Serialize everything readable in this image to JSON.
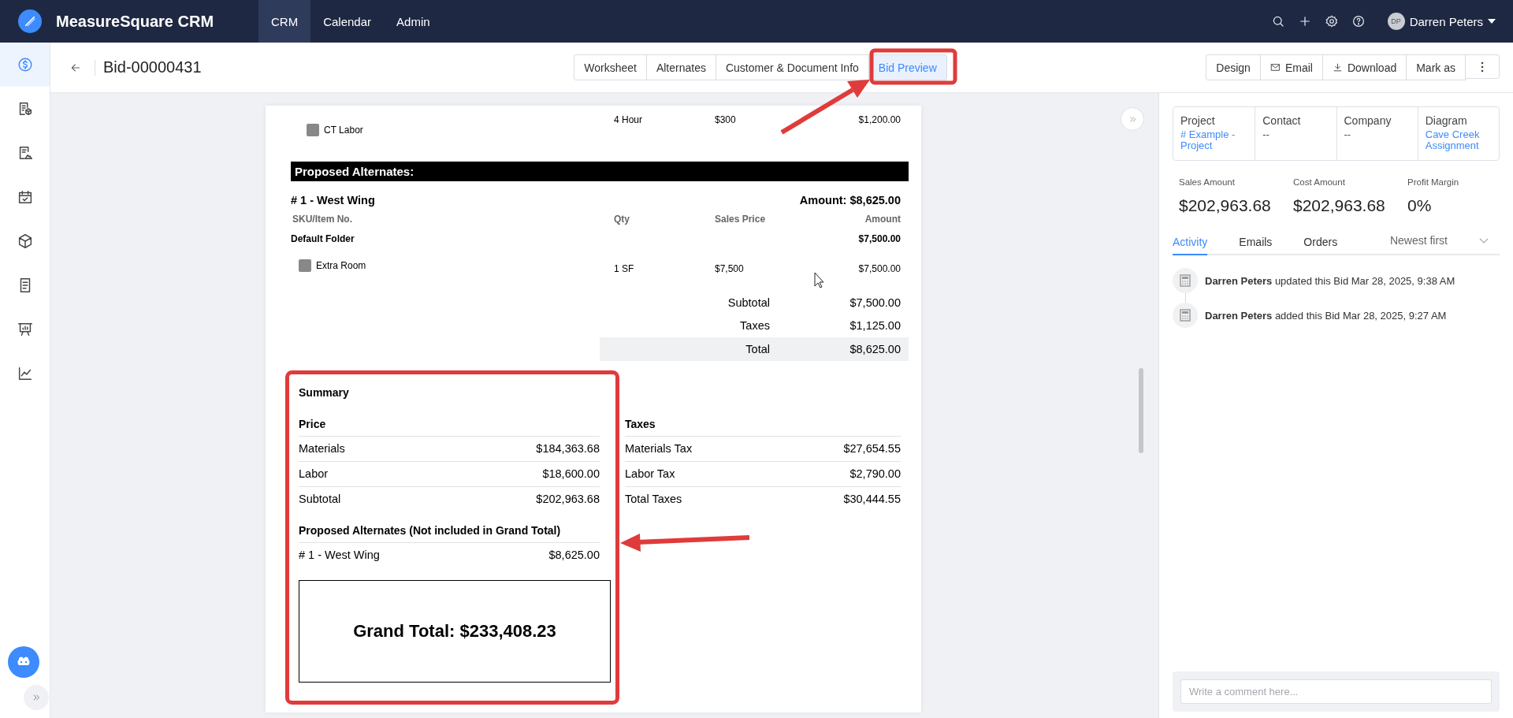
{
  "app": {
    "title": "MeasureSquare CRM",
    "nav": [
      {
        "label": "CRM",
        "selected": true
      },
      {
        "label": "Calendar",
        "selected": false
      },
      {
        "label": "Admin",
        "selected": false
      }
    ],
    "user": {
      "initials": "DP",
      "name": "Darren Peters"
    }
  },
  "sidebar": {
    "items": [
      {
        "selected": true
      },
      {
        "selected": false
      },
      {
        "selected": false
      },
      {
        "selected": false
      },
      {
        "selected": false
      },
      {
        "selected": false
      },
      {
        "selected": false
      },
      {
        "selected": false
      }
    ]
  },
  "header": {
    "title": "Bid-00000431",
    "tabs": [
      {
        "label": "Worksheet",
        "selected": false
      },
      {
        "label": "Alternates",
        "selected": false
      },
      {
        "label": "Customer & Document Info",
        "selected": false
      },
      {
        "label": "Bid Preview",
        "selected": true
      }
    ],
    "actions": [
      {
        "label": "Design",
        "kind": "plain"
      },
      {
        "label": "Email",
        "kind": "email"
      },
      {
        "label": "Download",
        "kind": "download"
      },
      {
        "label": "Mark as",
        "kind": "plain"
      }
    ]
  },
  "document": {
    "labor_line": {
      "name": "CT Labor",
      "qty": "4 Hour",
      "price": "$300",
      "amount": "$1,200.00"
    },
    "alternates": {
      "heading": "Proposed Alternates:",
      "title": "# 1 - West Wing",
      "amount": "Amount: $8,625.00",
      "columns": [
        "SKU/Item No.",
        "Qty",
        "Sales Price",
        "Amount"
      ],
      "folder": {
        "name": "Default Folder",
        "amount": "$7,500.00"
      },
      "items": [
        {
          "name": "Extra Room",
          "qty": "1 SF",
          "price": "$7,500",
          "amount": "$7,500.00"
        }
      ],
      "totals": [
        {
          "label": "Subtotal",
          "value": "$7,500.00",
          "highlighted": false
        },
        {
          "label": "Taxes",
          "value": "$1,125.00",
          "highlighted": false
        },
        {
          "label": "Total",
          "value": "$8,625.00",
          "highlighted": true
        }
      ]
    },
    "summary": {
      "title": "Summary",
      "price": {
        "heading": "Price",
        "rows": [
          {
            "label": "Materials",
            "value": "$184,363.68"
          },
          {
            "label": "Labor",
            "value": "$18,600.00"
          },
          {
            "label": "Subtotal",
            "value": "$202,963.68"
          }
        ]
      },
      "taxes": {
        "heading": "Taxes",
        "rows": [
          {
            "label": "Materials Tax",
            "value": "$27,654.55"
          },
          {
            "label": "Labor Tax",
            "value": "$2,790.00"
          },
          {
            "label": "Total Taxes",
            "value": "$30,444.55"
          }
        ]
      },
      "alternates": {
        "heading": "Proposed Alternates (Not included in Grand Total)",
        "rows": [
          {
            "label": "# 1 - West Wing",
            "value": "$8,625.00"
          }
        ]
      },
      "grand_total": "Grand Total: $233,408.23"
    }
  },
  "panel": {
    "info": [
      {
        "label": "Project",
        "value": "# Example - Project",
        "link": true
      },
      {
        "label": "Contact",
        "value": "--",
        "link": false
      },
      {
        "label": "Company",
        "value": "--",
        "link": false
      },
      {
        "label": "Diagram",
        "value": "Cave Creek Assignment",
        "link": true
      }
    ],
    "stats": [
      {
        "label": "Sales Amount",
        "value": "$202,963.68"
      },
      {
        "label": "Cost Amount",
        "value": "$202,963.68"
      },
      {
        "label": "Profit Margin",
        "value": "0%"
      }
    ],
    "tabs": [
      {
        "label": "Activity",
        "selected": true
      },
      {
        "label": "Emails",
        "selected": false
      },
      {
        "label": "Orders",
        "selected": false
      }
    ],
    "sort": "Newest first",
    "activity": [
      {
        "text": "**Darren Peters** updated this Bid Mar 28, 2025, 9:38 AM"
      },
      {
        "text": "**Darren Peters** added this Bid Mar 28, 2025, 9:27 AM"
      }
    ],
    "comment": {
      "placeholder": "Write a comment here..."
    }
  }
}
